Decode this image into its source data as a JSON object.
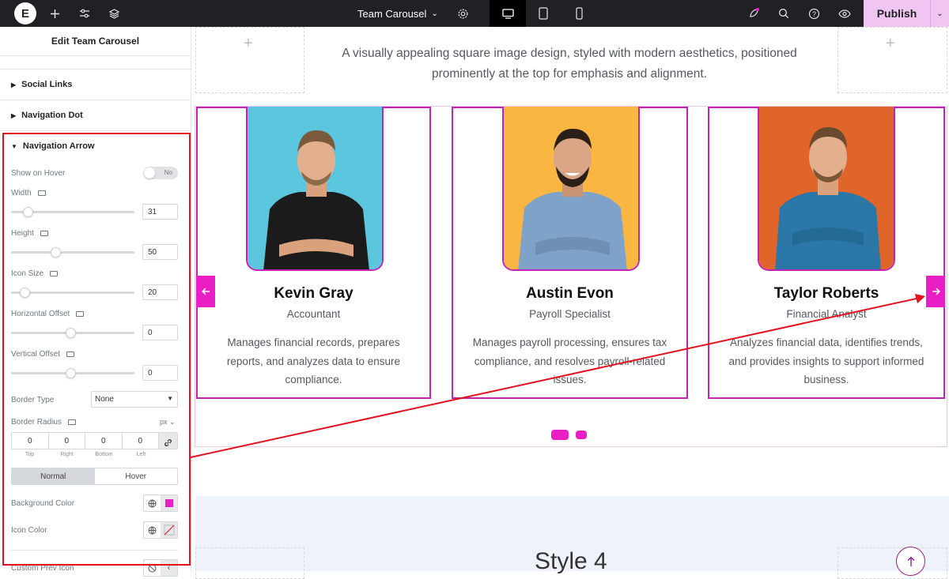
{
  "topbar": {
    "logo": "E",
    "doc_title": "Team Carousel",
    "publish_label": "Publish"
  },
  "panel": {
    "title": "Edit Team Carousel",
    "sections": [
      {
        "label": "Social Links",
        "expanded": false
      },
      {
        "label": "Navigation Dot",
        "expanded": false
      },
      {
        "label": "Navigation Arrow",
        "expanded": true
      }
    ],
    "show_on_hover": {
      "label": "Show on Hover",
      "value": "No"
    },
    "width": {
      "label": "Width",
      "value": "31",
      "fraction": 0.14
    },
    "height": {
      "label": "Height",
      "value": "50",
      "fraction": 0.37
    },
    "icon_size": {
      "label": "Icon Size",
      "value": "20",
      "fraction": 0.11
    },
    "horizontal_offset": {
      "label": "Horizontal Offset",
      "value": "0",
      "fraction": 0.5
    },
    "vertical_offset": {
      "label": "Vertical Offset",
      "value": "0",
      "fraction": 0.5
    },
    "border_type": {
      "label": "Border Type",
      "value": "None"
    },
    "border_radius": {
      "label": "Border Radius",
      "unit": "px",
      "values": [
        "0",
        "0",
        "0",
        "0"
      ],
      "sides": [
        "Top",
        "Right",
        "Bottom",
        "Left"
      ]
    },
    "state_tabs": [
      "Normal",
      "Hover"
    ],
    "background_color": {
      "label": "Background Color",
      "color": "#e91ec4"
    },
    "icon_color": {
      "label": "Icon Color"
    },
    "custom_prev_icon": {
      "label": "Custom Prev Icon"
    }
  },
  "canvas": {
    "intro_text": "A visually appealing square image design, styled with modern aesthetics, positioned prominently at the top for emphasis and alignment.",
    "members": [
      {
        "name": "Kevin Gray",
        "role": "Accountant",
        "desc": "Manages financial records, prepares reports, and analyzes data to ensure compliance.",
        "bg": "#5cc6de",
        "shirt": "#1b1b1b"
      },
      {
        "name": "Austin Evon",
        "role": "Payroll Specialist",
        "desc": "Manages payroll processing, ensures tax compliance, and resolves payroll-related issues.",
        "bg": "#f9b643",
        "shirt": "#7fa3c8"
      },
      {
        "name": "Taylor Roberts",
        "role": "Financial Analyst",
        "desc": "Analyzes financial data, identifies trends, and provides insights to support informed business.",
        "bg": "#e0652b",
        "shirt": "#2b78a8"
      }
    ],
    "next_heading": "Style 4"
  },
  "colors": {
    "accent": "#e91ec4",
    "card_border": "#c423b6",
    "annotation": "#e3101e"
  }
}
